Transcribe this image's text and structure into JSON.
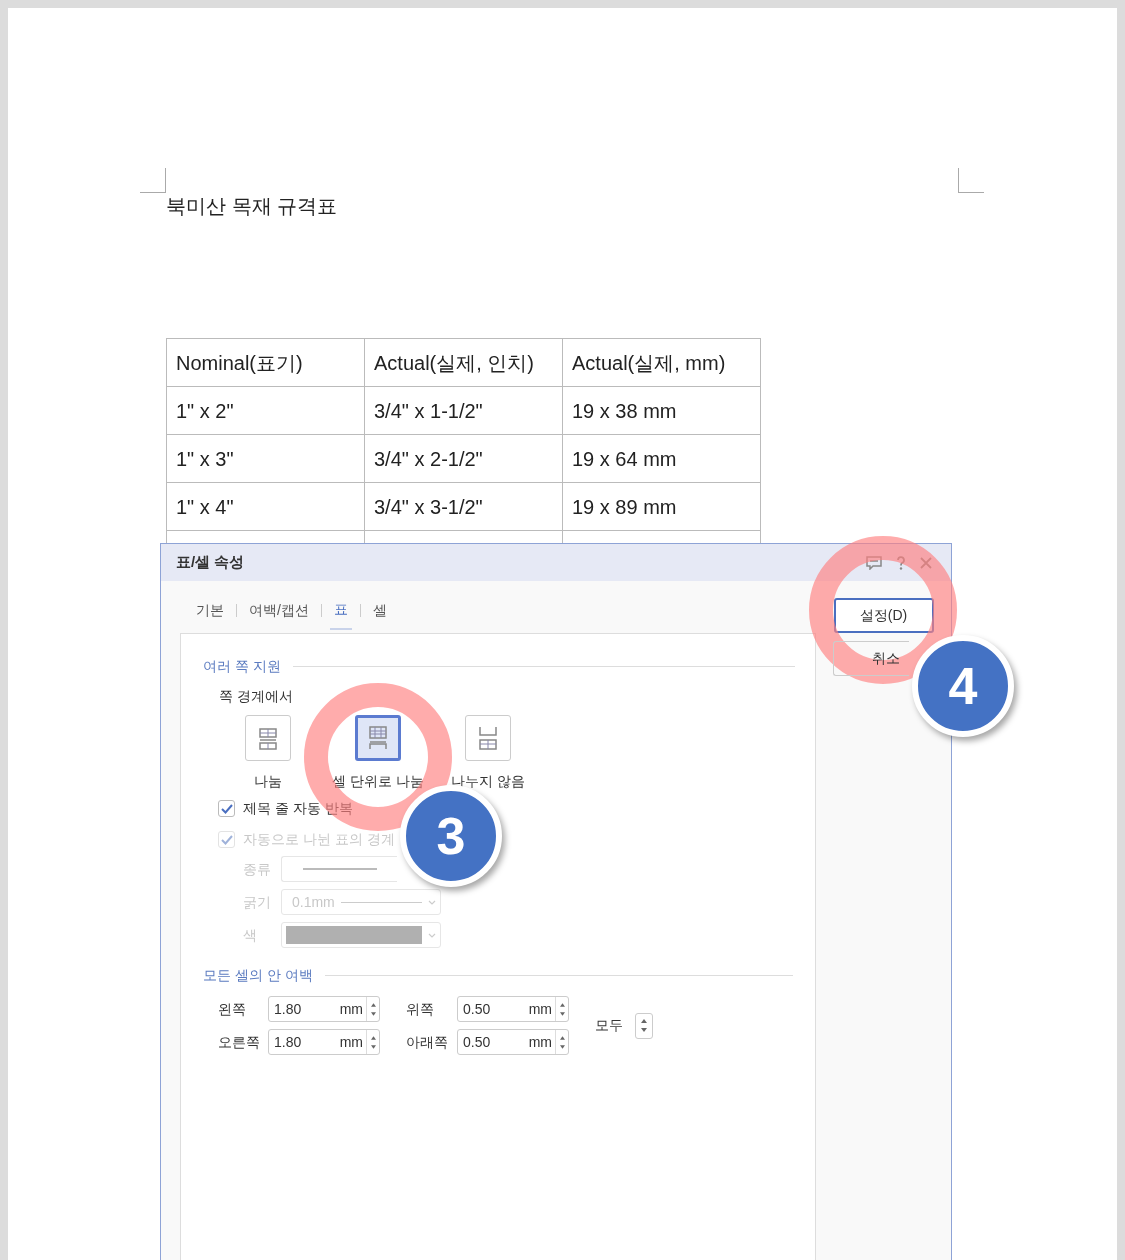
{
  "document": {
    "title": "북미산 목재 규격표",
    "table": {
      "columns": [
        "Nominal(표기)",
        "Actual(실제, 인치)",
        "Actual(실제, mm)"
      ],
      "rows": [
        [
          "1\" x 2\"",
          "3/4\" x 1-1/2\"",
          "19 x 38 mm"
        ],
        [
          "1\" x 3\"",
          "3/4\" x 2-1/2\"",
          "19 x 64 mm"
        ],
        [
          "1\" x 4\"",
          "3/4\" x 3-1/2\"",
          "19 x 89 mm"
        ]
      ]
    }
  },
  "dialog": {
    "title": "표/셀 속성",
    "tabs": [
      {
        "label": "기본",
        "selected": false
      },
      {
        "label": "여백/캡션",
        "selected": false
      },
      {
        "label": "표",
        "selected": true
      },
      {
        "label": "셀",
        "selected": false
      }
    ],
    "buttons": [
      {
        "label": "설정(D)",
        "default": true
      },
      {
        "label": "취소",
        "default": false
      }
    ],
    "section_1": {
      "title": "여러 쪽 지원",
      "subtitle": "쪽 경계에서",
      "split_options": [
        {
          "label": "나눔",
          "kind": "split",
          "selected": false
        },
        {
          "label": "셀 단위로 나눔",
          "kind": "cell",
          "selected": true
        },
        {
          "label": "나누지 않음",
          "kind": "none",
          "selected": false
        }
      ],
      "checkboxes": [
        {
          "label": "제목 줄 자동 반복",
          "checked": true,
          "disabled": false
        },
        {
          "label": "자동으로 나뉜 표의 경계",
          "checked": true,
          "disabled": true
        }
      ],
      "border_fields": [
        {
          "label": "종류",
          "kind": "line",
          "disabled": true
        },
        {
          "label": "굵기",
          "kind": "weight",
          "value": "0.1mm",
          "disabled": true
        },
        {
          "label": "색",
          "kind": "color",
          "disabled": true
        }
      ]
    },
    "section_2": {
      "title": "모든 셀의 안 여백",
      "fields": [
        {
          "label": "왼쪽",
          "value": "1.80",
          "unit": "mm"
        },
        {
          "label": "위쪽",
          "value": "0.50",
          "unit": "mm"
        },
        {
          "label": "오른쪽",
          "value": "1.80",
          "unit": "mm"
        },
        {
          "label": "아래쪽",
          "value": "0.50",
          "unit": "mm"
        }
      ],
      "all_label": "모두"
    }
  },
  "annotations": [
    {
      "number": "3"
    },
    {
      "number": "4"
    }
  ]
}
